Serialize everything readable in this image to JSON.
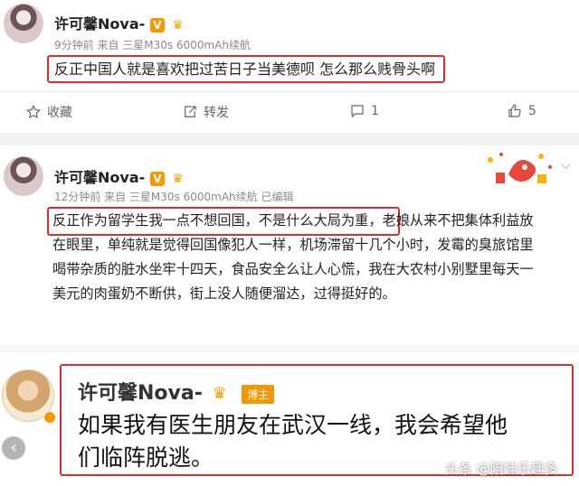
{
  "post1": {
    "author": "许可馨Nova-",
    "badge": "V",
    "meta": "9分钟前 来自 三星M30s 6000mAh续航",
    "text": "反正中国人就是喜欢把过苦日子当美德呗 怎么那么贱骨头啊",
    "actions": {
      "favorite_label": "收藏",
      "repost_label": "转发",
      "comment_count": "1",
      "like_count": "5"
    }
  },
  "post2": {
    "author": "许可馨Nova-",
    "badge": "V",
    "meta": "12分钟前 来自 三星M30s 6000mAh续航  已编辑",
    "text_lines": [
      "反正作为留学生我一点不想回国，不是什么大局为重，老娘从来不把集体利益放",
      "在眼里，单纯就是觉得回国像犯人一样，机场滞留十几个小时，发霉的臭旅馆里",
      "喝带杂质的脏水坐牢十四天，食品安全么让人心慌，我在大农村小别墅里每天一",
      "美元的肉蛋奶不断供，街上没人随便溜达，过得挺好的。"
    ]
  },
  "post3": {
    "author": "许可馨Nova-",
    "host_badge": "博主",
    "text_lines": [
      "如果我有医生朋友在武汉一线，我会希望他",
      "们临阵脱逃。"
    ]
  },
  "watermark": "头条 @陪娃乐趣多",
  "colors": {
    "highlight": "#d8302f",
    "badge": "#f39800"
  }
}
